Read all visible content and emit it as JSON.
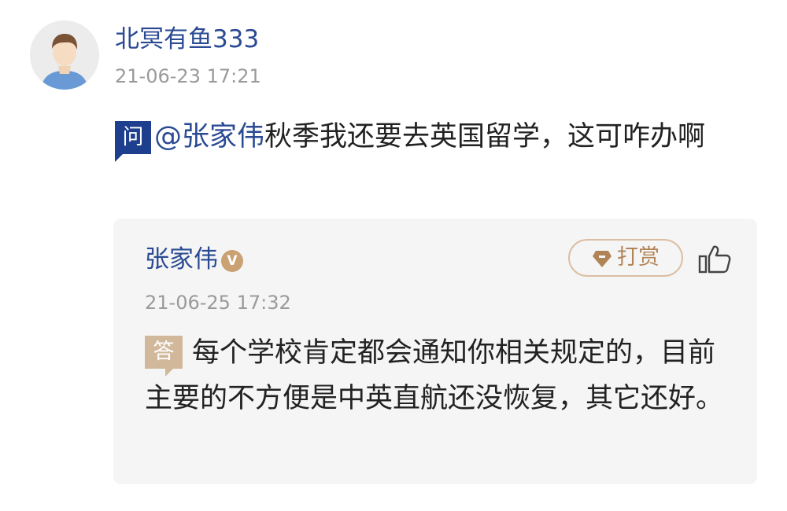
{
  "comment": {
    "avatar_icon": "default-user-avatar-icon",
    "username": "北冥有鱼333",
    "timestamp": "21-06-23 17:21",
    "question_badge": "问",
    "mention": "@张家伟",
    "question_text": "秋季我还要去英国留学，这可咋办啊"
  },
  "answer": {
    "answerer_name": "张家伟",
    "verified_badge": "V",
    "tip_label": "打赏",
    "tip_icon": "gem-icon",
    "like_icon": "thumbs-up-icon",
    "timestamp": "21-06-25 17:32",
    "answer_badge": "答",
    "answer_text": "每个学校肯定都会通知你相关规定的，目前主要的不方便是中英直航还没恢复，其它还好。"
  },
  "colors": {
    "link_blue": "#2a4a93",
    "question_badge": "#1e3e8e",
    "answer_badge": "#d2b89a",
    "tip_accent": "#b18457",
    "card_bg": "#f5f5f5",
    "muted_text": "#9a9a9a"
  }
}
